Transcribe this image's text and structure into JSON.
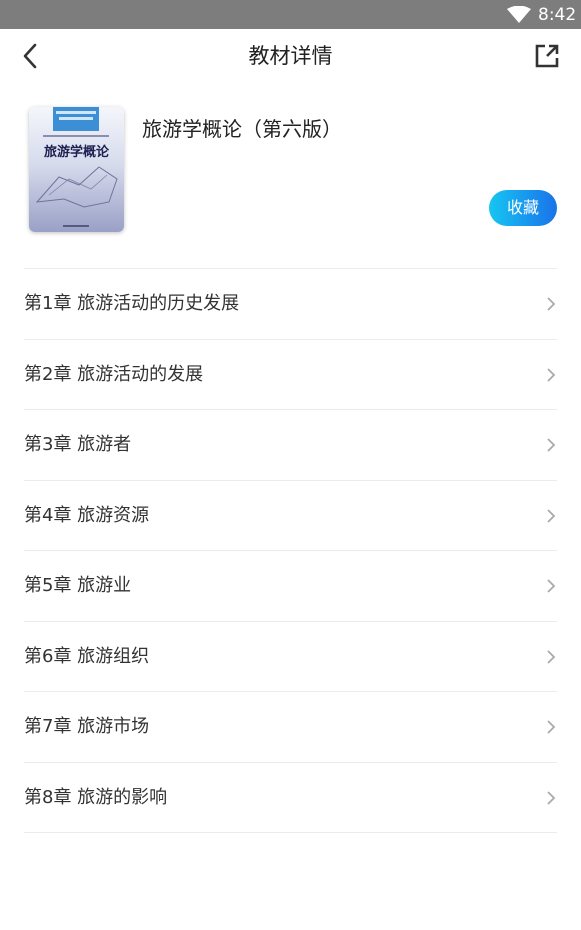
{
  "status_bar": {
    "time": "8:42",
    "wifi_icon": "wifi-icon"
  },
  "header": {
    "title": "教材详情",
    "back_icon": "chevron-left-icon",
    "share_icon": "external-link-icon"
  },
  "book": {
    "name": "旅游学概论（第六版）",
    "cover_title": "旅游学概论",
    "favorite_label": "收藏",
    "accent_color_start": "#16c6f2",
    "accent_color_end": "#1a72ea"
  },
  "chapters": [
    {
      "label": "第1章  旅游活动的历史发展"
    },
    {
      "label": "第2章  旅游活动的发展"
    },
    {
      "label": "第3章 旅游者"
    },
    {
      "label": "第4章 旅游资源"
    },
    {
      "label": "第5章  旅游业"
    },
    {
      "label": "第6章  旅游组织"
    },
    {
      "label": "第7章 旅游市场"
    },
    {
      "label": "第8章 旅游的影响"
    }
  ]
}
